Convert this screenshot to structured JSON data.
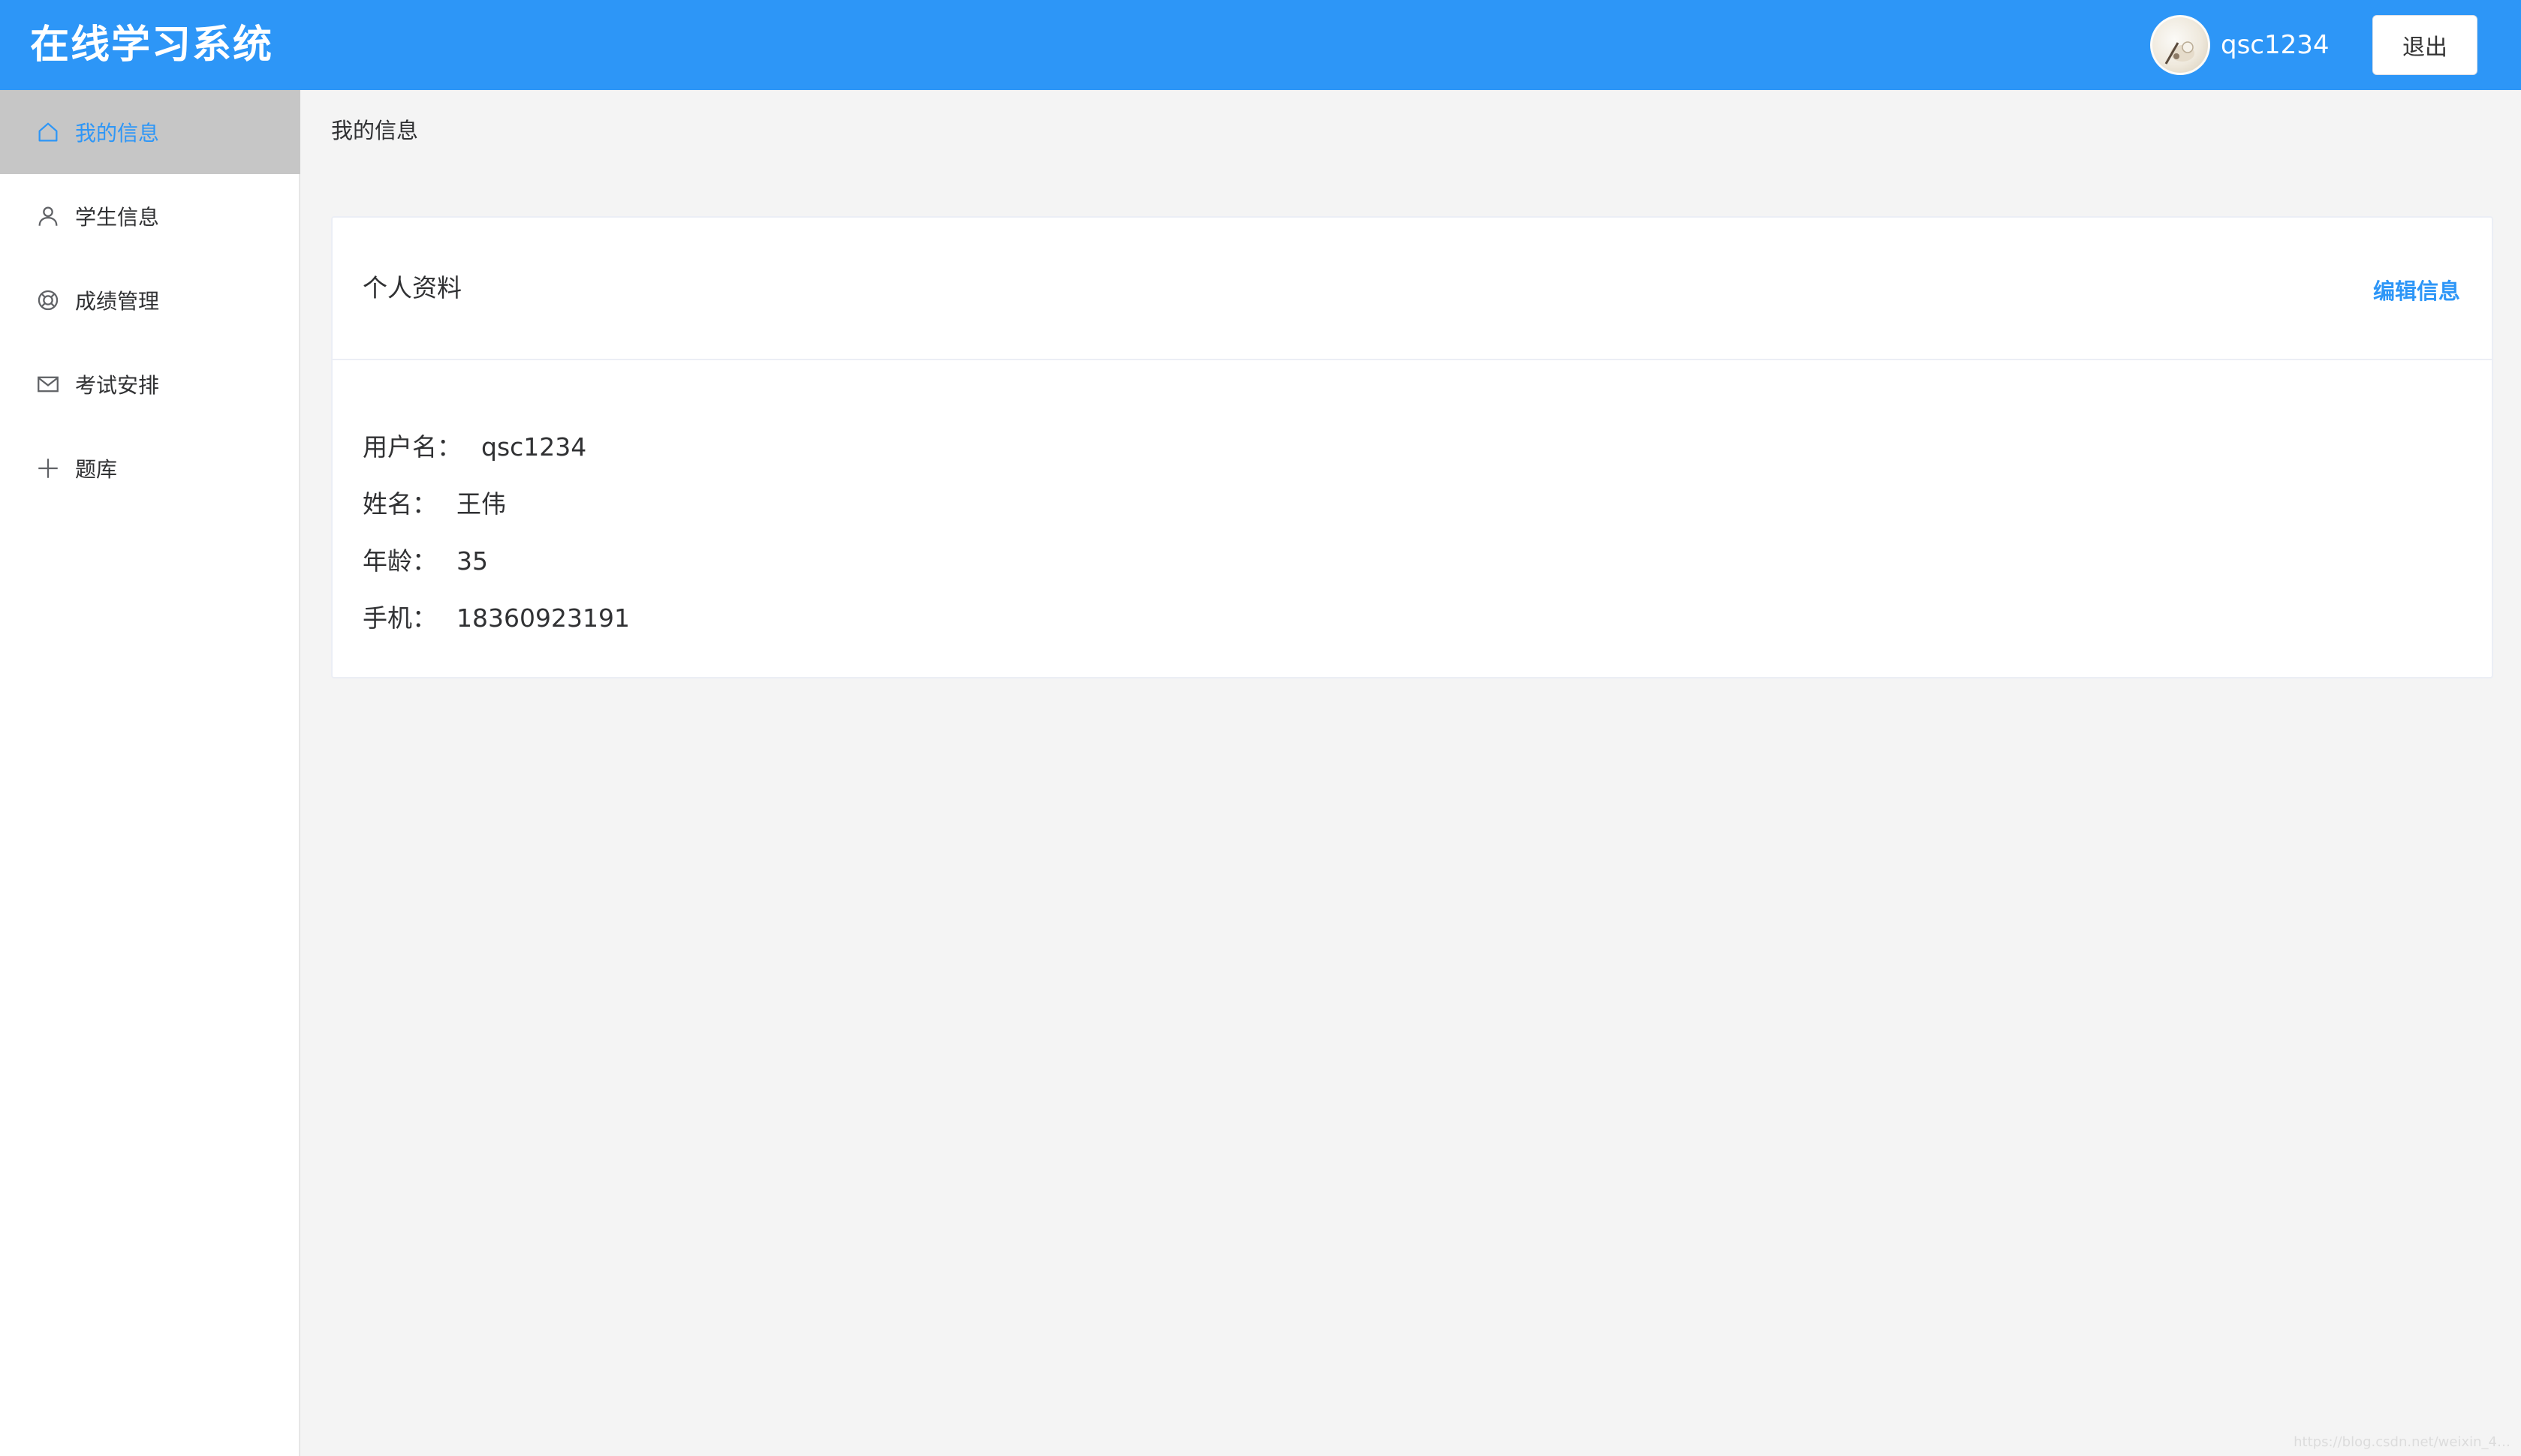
{
  "header": {
    "app_title": "在线学习系统",
    "username": "qsc1234",
    "logout_label": "退出",
    "bg_color": "#2d96f7"
  },
  "sidebar": {
    "items": [
      {
        "label": "我的信息",
        "icon": "home-icon",
        "active": true
      },
      {
        "label": "学生信息",
        "icon": "user-icon",
        "active": false
      },
      {
        "label": "成绩管理",
        "icon": "lifebuoy-icon",
        "active": false
      },
      {
        "label": "考试安排",
        "icon": "mail-icon",
        "active": false
      },
      {
        "label": "题库",
        "icon": "plus-icon",
        "active": false
      }
    ]
  },
  "main": {
    "breadcrumb": "我的信息",
    "card": {
      "title": "个人资料",
      "edit_label": "编辑信息",
      "fields": [
        {
          "label": "用户名：",
          "value": "qsc1234"
        },
        {
          "label": "姓名：",
          "value": "王伟"
        },
        {
          "label": "年龄：",
          "value": "35"
        },
        {
          "label": "手机：",
          "value": "18360923191"
        }
      ]
    }
  },
  "watermark": "https://blog.csdn.net/weixin_4…"
}
